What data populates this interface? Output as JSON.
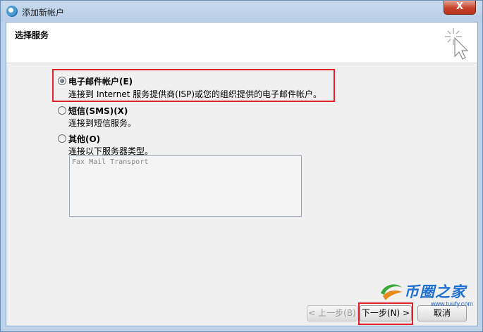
{
  "window": {
    "title": "添加新帐户",
    "close_label": "X"
  },
  "header": {
    "title": "选择服务"
  },
  "options": [
    {
      "label": "电子邮件帐户(E)",
      "description": "连接到 Internet 服务提供商(ISP)或您的组织提供的电子邮件帐户。",
      "selected": true
    },
    {
      "label": "短信(SMS)(X)",
      "description": "连接到短信服务。",
      "selected": false
    },
    {
      "label": "其他(O)",
      "description": "连接以下服务器类型。",
      "selected": false
    }
  ],
  "listbox": {
    "items": [
      "Fax Mail Transport"
    ]
  },
  "buttons": {
    "back": "< 上一步(B)",
    "next": "下一步(N) >",
    "cancel": "取消"
  },
  "watermark": {
    "brand": "币圈之家",
    "url": "www.tuufy.com"
  },
  "colors": {
    "highlight": "#e0202a",
    "title_bar": "#bcd3ea"
  }
}
